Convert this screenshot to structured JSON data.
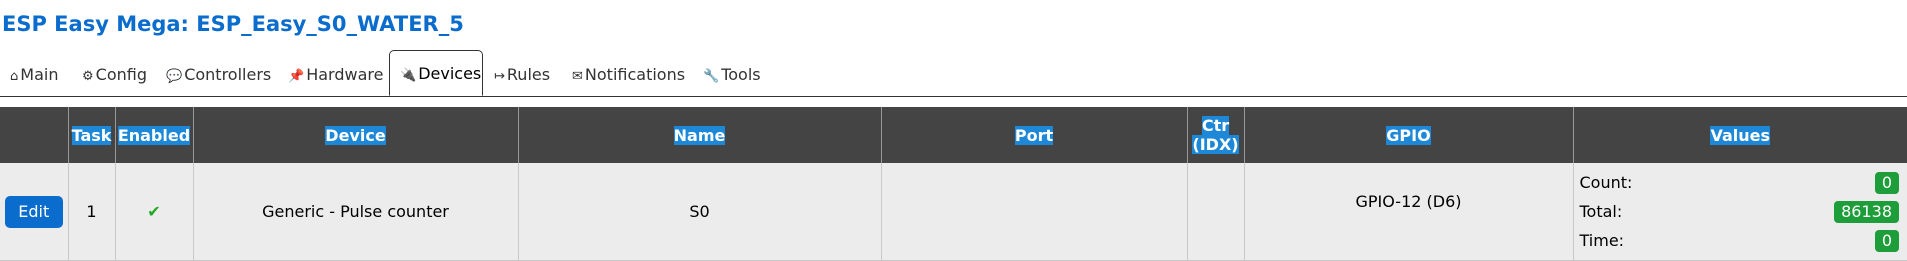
{
  "header": {
    "title": "ESP Easy Mega: ESP_Easy_S0_WATER_5"
  },
  "tabs": [
    {
      "icon": "⌂",
      "label": "Main"
    },
    {
      "icon": "⚙",
      "label": "Config"
    },
    {
      "icon": "💬",
      "label": "Controllers"
    },
    {
      "icon": "📌",
      "label": "Hardware"
    },
    {
      "icon": "🔌",
      "label": "Devices"
    },
    {
      "icon": "↦",
      "label": "Rules"
    },
    {
      "icon": "✉",
      "label": "Notifications"
    },
    {
      "icon": "🔧",
      "label": "Tools"
    }
  ],
  "active_tab": "Devices",
  "table": {
    "headers": [
      "Task",
      "Enabled",
      "Device",
      "Name",
      "Port",
      "Ctr (IDX)",
      "GPIO",
      "Values"
    ],
    "rows": [
      {
        "edit_label": "Edit",
        "task": "1",
        "enabled": "✔",
        "device": "Generic - Pulse counter",
        "name": "S0",
        "port": "",
        "ctr_idx": "",
        "gpio": "GPIO-12 (D6)",
        "values": [
          {
            "label": "Count:",
            "value": "0"
          },
          {
            "label": "Total:",
            "value": "86138"
          },
          {
            "label": "Time:",
            "value": "0"
          }
        ]
      }
    ]
  },
  "colors": {
    "title": "#0a6ccc",
    "header_bg": "#444444",
    "header_highlight": "#1e88d8",
    "edit_button": "#0a6ccc",
    "value_badge": "#1e9e3a",
    "check": "#22aa22"
  }
}
